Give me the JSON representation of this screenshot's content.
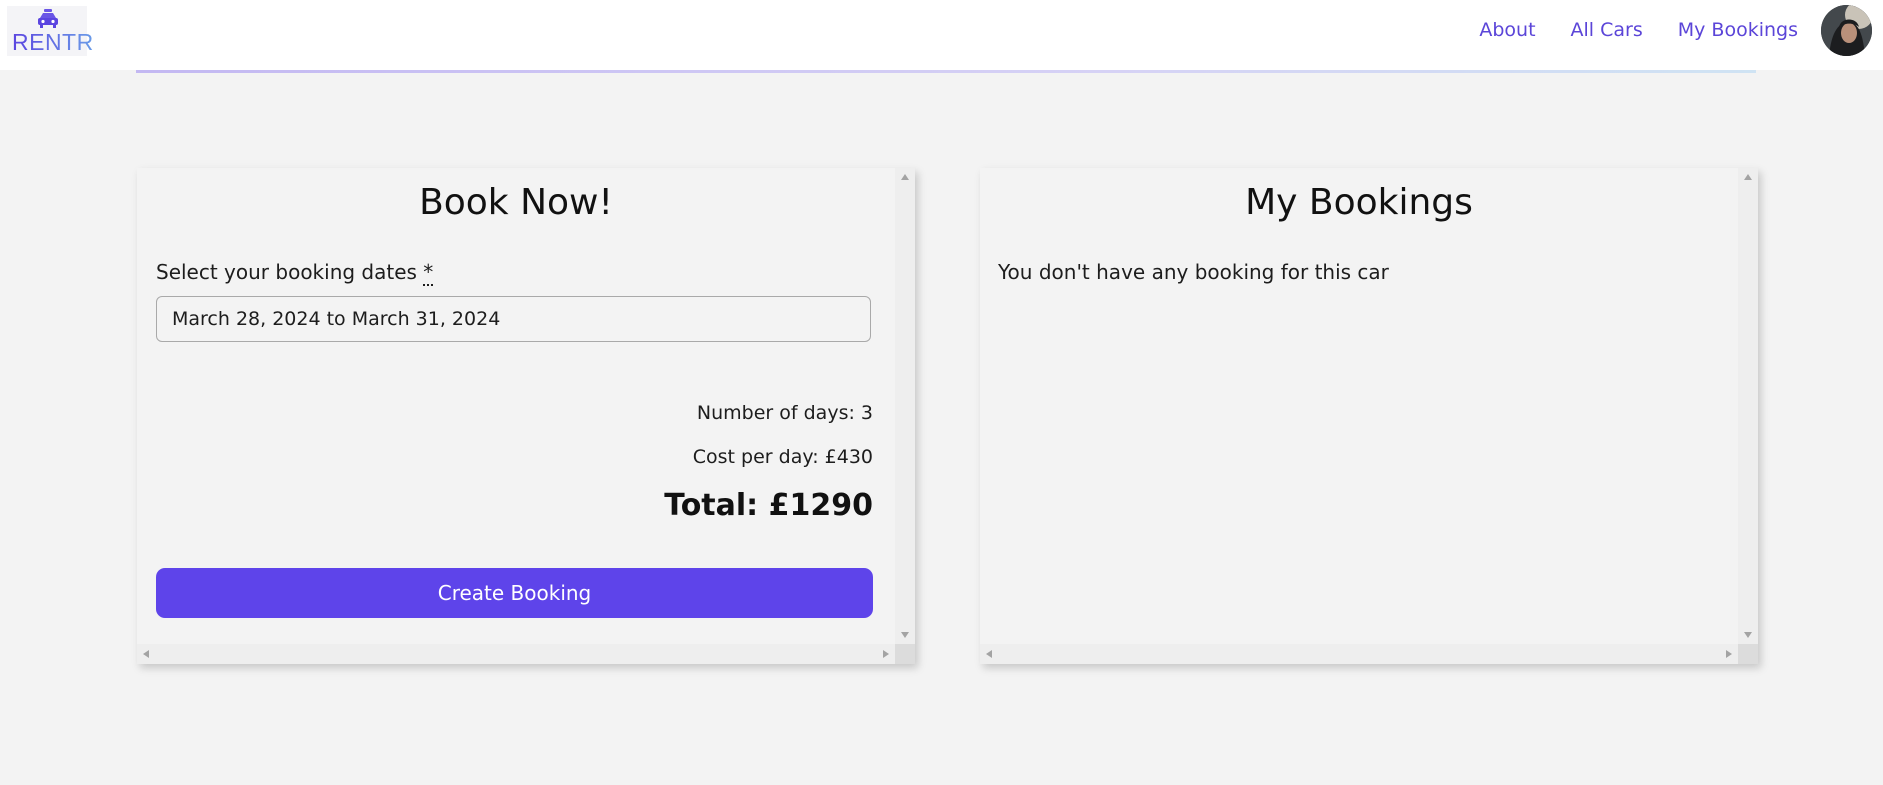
{
  "header": {
    "logo_text": "RENTR",
    "nav": [
      {
        "label": "About"
      },
      {
        "label": "All Cars"
      },
      {
        "label": "My Bookings"
      }
    ]
  },
  "booking": {
    "title": "Book Now!",
    "dates_label": "Select your booking dates",
    "required_mark": "*",
    "required_title": "required",
    "dates_value": "March 28, 2024 to March 31, 2024",
    "days_text": "Number of days: 3",
    "cost_text": "Cost per day: £430",
    "total_text": "Total: £1290",
    "button_label": "Create Booking"
  },
  "my_bookings": {
    "title": "My Bookings",
    "empty_message": "You don't have any booking for this car"
  },
  "colors": {
    "accent": "#5e44ea",
    "nav_link": "#5b45d8",
    "background": "#f3f3f3"
  }
}
